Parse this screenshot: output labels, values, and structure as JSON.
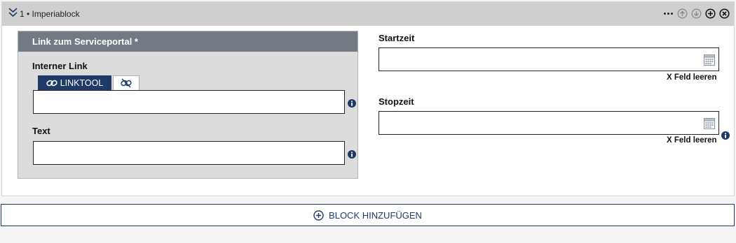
{
  "block": {
    "title": "1 • Imperiablock",
    "actions": [
      "more-icon",
      "move-up-icon",
      "move-down-icon",
      "add-icon",
      "remove-icon"
    ]
  },
  "link_group": {
    "title": "Link zum Serviceportal *",
    "internal_link_label": "Interner Link",
    "tabs": {
      "linktool": "LINKTOOL",
      "unlink_icon": "unlink-icon"
    },
    "internal_link_value": "",
    "text_label": "Text",
    "text_value": ""
  },
  "start": {
    "label": "Startzeit",
    "value": "",
    "clear": "X Feld leeren"
  },
  "stop": {
    "label": "Stopzeit",
    "value": "",
    "clear": "X Feld leeren"
  },
  "add_block": {
    "label": "BLOCK HINZUFÜGEN"
  },
  "colors": {
    "header_bg": "#cfcfcf",
    "group_title_bg": "#727a84",
    "accent": "#1f3a66",
    "info": "#1f3a66"
  }
}
